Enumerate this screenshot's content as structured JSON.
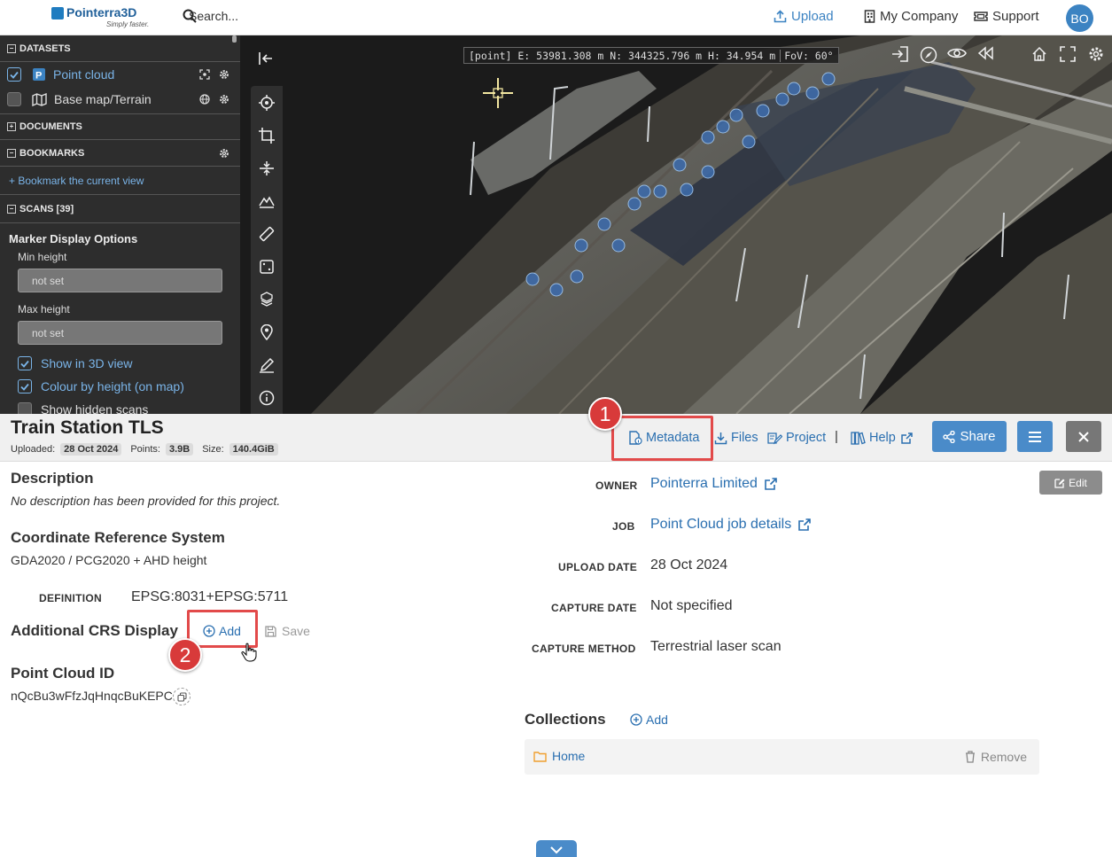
{
  "topbar": {
    "logo_brand": "Pointerra3D",
    "logo_tagline": "Simply faster.",
    "search_placeholder": "Search...",
    "upload": "Upload",
    "my_company": "My Company",
    "support": "Support",
    "avatar_initials": "BO"
  },
  "sidebar": {
    "datasets_header": "DATASETS",
    "datasets": [
      {
        "label": "Point cloud",
        "checked": true
      },
      {
        "label": "Base map/Terrain",
        "checked": false
      }
    ],
    "documents_header": "DOCUMENTS",
    "bookmarks_header": "BOOKMARKS",
    "bookmark_link": "+ Bookmark the current view",
    "scans_header": "SCANS [39]",
    "marker_display_options": "Marker Display Options",
    "min_height_label": "Min height",
    "min_height_value": "not set",
    "max_height_label": "Max height",
    "max_height_value": "not set",
    "options": [
      {
        "label": "Show in 3D view",
        "checked": true
      },
      {
        "label": "Colour by height (on map)",
        "checked": true
      },
      {
        "label": "Show hidden scans",
        "checked": false
      }
    ]
  },
  "viewer": {
    "coord_readout": "[point] E: 53981.308 m  N: 344325.796 m  H: 34.954 m",
    "fov": "FoV: 60°",
    "tools": [
      "target-icon",
      "crop-icon",
      "section-icon",
      "terrain-icon",
      "ruler-icon",
      "area-icon",
      "volume-icon",
      "location-pin-icon",
      "annotate-icon",
      "info-icon"
    ]
  },
  "project": {
    "title": "Train Station TLS",
    "uploaded_label": "Uploaded:",
    "uploaded": "28 Oct 2024",
    "points_label": "Points:",
    "points": "3.9B",
    "size_label": "Size:",
    "size": "140.4GiB",
    "tabs": {
      "metadata": "Metadata",
      "files": "Files",
      "project": "Project",
      "separator": "|",
      "help": "Help"
    },
    "share": "Share"
  },
  "details": {
    "description_heading": "Description",
    "description_text": "No description has been provided for this project.",
    "crs_heading": "Coordinate Reference System",
    "crs_text": "GDA2020 / PCG2020 + AHD height",
    "definition_label": "DEFINITION",
    "definition_value": "EPSG:8031+EPSG:5711",
    "additional_crs_heading": "Additional CRS Display",
    "add_label": "Add",
    "save_label": "Save",
    "pointcloud_id_heading": "Point Cloud ID",
    "pointcloud_id": "nQcBu3wFfzJqHnqcBuKEPC",
    "edit_label": "Edit",
    "owner_label": "OWNER",
    "owner_value": "Pointerra Limited",
    "job_label": "JOB",
    "job_value": "Point Cloud job details",
    "upload_date_label": "UPLOAD DATE",
    "upload_date_value": "28 Oct 2024",
    "capture_date_label": "CAPTURE DATE",
    "capture_date_value": "Not specified",
    "capture_method_label": "CAPTURE METHOD",
    "capture_method_value": "Terrestrial laser scan",
    "collections_heading": "Collections",
    "collections_add": "Add",
    "collection_item": "Home",
    "collection_remove": "Remove"
  },
  "annotations": {
    "step1": "1",
    "step2": "2",
    "highlight_color": "#e24a4a"
  },
  "colors": {
    "accent": "#4a8bc9",
    "link": "#2a6fb0",
    "sidebar_bg": "#2d2d2d"
  }
}
